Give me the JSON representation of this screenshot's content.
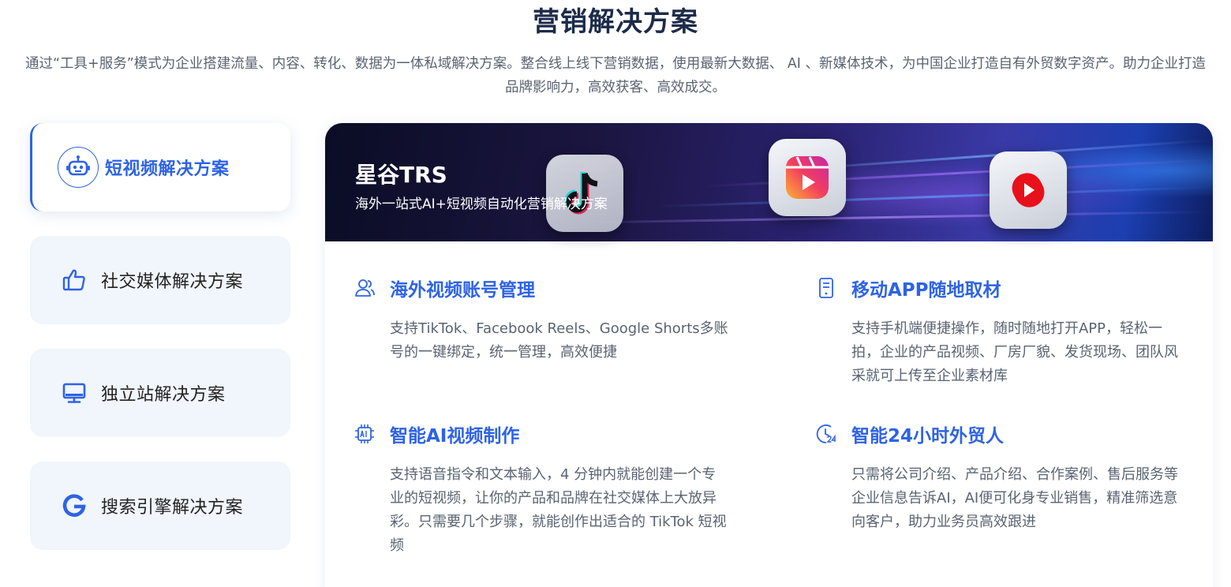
{
  "header": {
    "title": "营销解决方案",
    "subtitle": "通过“工具+服务”模式为企业搭建流量、内容、转化、数据为一体私域解决方案。整合线上线下营销数据，使用最新大数据、 AI 、新媒体技术，为中国企业打造自有外贸数字资产。助力企业打造品牌影响力，高效获客、高效成交。"
  },
  "sidebar": {
    "items": [
      {
        "label": "短视频解决方案",
        "icon": "robot-icon",
        "active": true
      },
      {
        "label": "社交媒体解决方案",
        "icon": "thumbs-up-icon",
        "active": false
      },
      {
        "label": "独立站解决方案",
        "icon": "monitor-icon",
        "active": false
      },
      {
        "label": "搜索引擎解决方案",
        "icon": "google-icon",
        "active": false
      }
    ]
  },
  "banner": {
    "title": "星谷TRS",
    "subtitle": "海外一站式AI+短视频自动化营销解决方案",
    "apps": [
      "tiktok-icon",
      "instagram-reels-icon",
      "youtube-shorts-icon"
    ]
  },
  "features": [
    {
      "title": "海外视频账号管理",
      "icon": "users-icon",
      "desc": "支持TikTok、Facebook Reels、Google Shorts多账号的一键绑定，统一管理，高效便捷"
    },
    {
      "title": "移动APP随地取材",
      "icon": "mobile-icon",
      "desc": "支持手机端便捷操作，随时随地打开APP，轻松一拍，企业的产品视频、厂房厂貌、发货现场、团队风采就可上传至企业素材库"
    },
    {
      "title": "智能AI视频制作",
      "icon": "ai-chip-icon",
      "desc": "支持语音指令和文本输入，4 分钟内就能创建一个专业的短视频，让你的产品和品牌在社交媒体上大放异彩。只需要几个步骤，就能创作出适合的 TikTok 短视频"
    },
    {
      "title": "智能24小时外贸人",
      "icon": "clock-24-icon",
      "desc": "只需将公司介绍、产品介绍、合作案例、售后服务等企业信息告诉AI，AI便可化身专业销售，精准筛选意向客户，助力业务员高效跟进"
    }
  ],
  "colors": {
    "accent": "#2e63e6",
    "title": "#1d2b4a",
    "text": "#5a6372",
    "sidebar_bg": "#f1f5fc"
  }
}
